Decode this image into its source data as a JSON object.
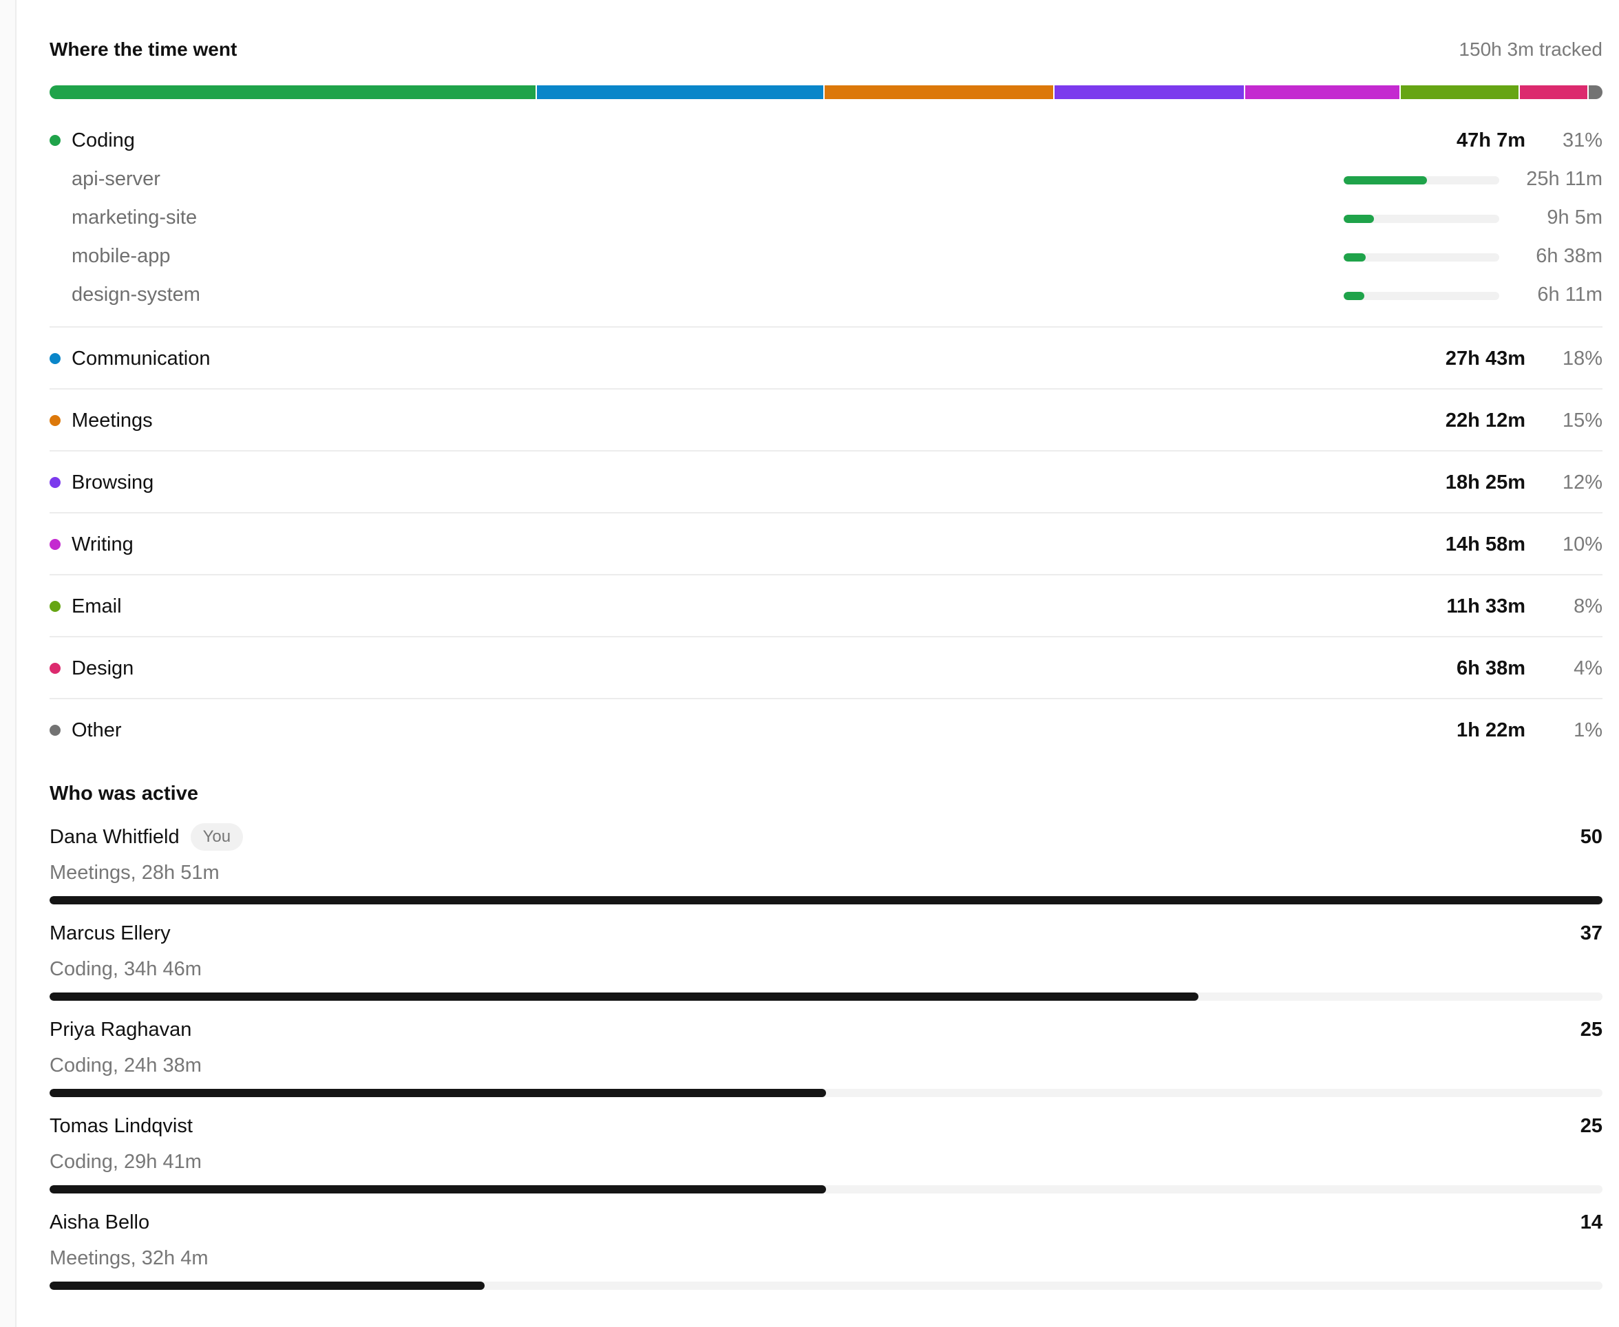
{
  "breakdown": {
    "title": "Where the time went",
    "total": "150h 3m tracked",
    "categories": [
      {
        "name": "Coding",
        "time": "47h 7m",
        "pct": "31%",
        "share": 31.4,
        "color": "#1fa34a",
        "projects": [
          {
            "name": "api-server",
            "time": "25h 11m",
            "share": 0.534
          },
          {
            "name": "marketing-site",
            "time": "9h 5m",
            "share": 0.193
          },
          {
            "name": "mobile-app",
            "time": "6h 38m",
            "share": 0.141
          },
          {
            "name": "design-system",
            "time": "6h 11m",
            "share": 0.131
          }
        ]
      },
      {
        "name": "Communication",
        "time": "27h 43m",
        "pct": "18%",
        "share": 18.5,
        "color": "#0a86c9"
      },
      {
        "name": "Meetings",
        "time": "22h 12m",
        "pct": "15%",
        "share": 14.8,
        "color": "#dc780a"
      },
      {
        "name": "Browsing",
        "time": "18h 25m",
        "pct": "12%",
        "share": 12.3,
        "color": "#7c3aed"
      },
      {
        "name": "Writing",
        "time": "14h 58m",
        "pct": "10%",
        "share": 10.0,
        "color": "#c42ad0"
      },
      {
        "name": "Email",
        "time": "11h 33m",
        "pct": "8%",
        "share": 7.7,
        "color": "#66a514"
      },
      {
        "name": "Design",
        "time": "6h 38m",
        "pct": "4%",
        "share": 4.4,
        "color": "#dc2a6e"
      },
      {
        "name": "Other",
        "time": "1h 22m",
        "pct": "1%",
        "share": 0.9,
        "color": "#737373"
      }
    ]
  },
  "activity": {
    "title": "Who was active",
    "you_badge": "You",
    "people": [
      {
        "name": "Dana Whitfield",
        "is_you": true,
        "score": "50",
        "detail": "Meetings, 28h 51m",
        "level": 1.0
      },
      {
        "name": "Marcus Ellery",
        "is_you": false,
        "score": "37",
        "detail": "Coding, 34h 46m",
        "level": 0.74
      },
      {
        "name": "Priya Raghavan",
        "is_you": false,
        "score": "25",
        "detail": "Coding, 24h 38m",
        "level": 0.5
      },
      {
        "name": "Tomas Lindqvist",
        "is_you": false,
        "score": "25",
        "detail": "Coding, 29h 41m",
        "level": 0.5
      },
      {
        "name": "Aisha Bello",
        "is_you": false,
        "score": "14",
        "detail": "Meetings, 32h 4m",
        "level": 0.28
      }
    ]
  }
}
